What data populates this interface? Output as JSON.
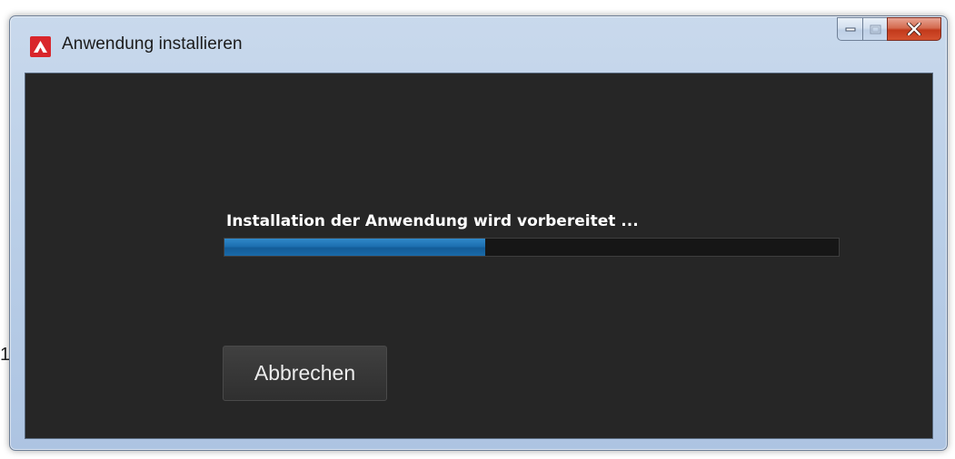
{
  "window": {
    "title": "Anwendung installieren",
    "app_icon": "adobe-air-icon",
    "caption_buttons": [
      "minimize-icon",
      "maximize-icon",
      "close-icon"
    ]
  },
  "installer": {
    "status_text": "Installation der Anwendung wird vorbereitet ...",
    "progress_fraction": 0.425,
    "cancel_label": "Abbrechen"
  },
  "background": {
    "edge_glyph": "1"
  },
  "colors": {
    "content_bg": "#262626",
    "progress_fill": "#1d6fb0",
    "close_button": "#c2391b",
    "icon_red": "#d9262b"
  }
}
